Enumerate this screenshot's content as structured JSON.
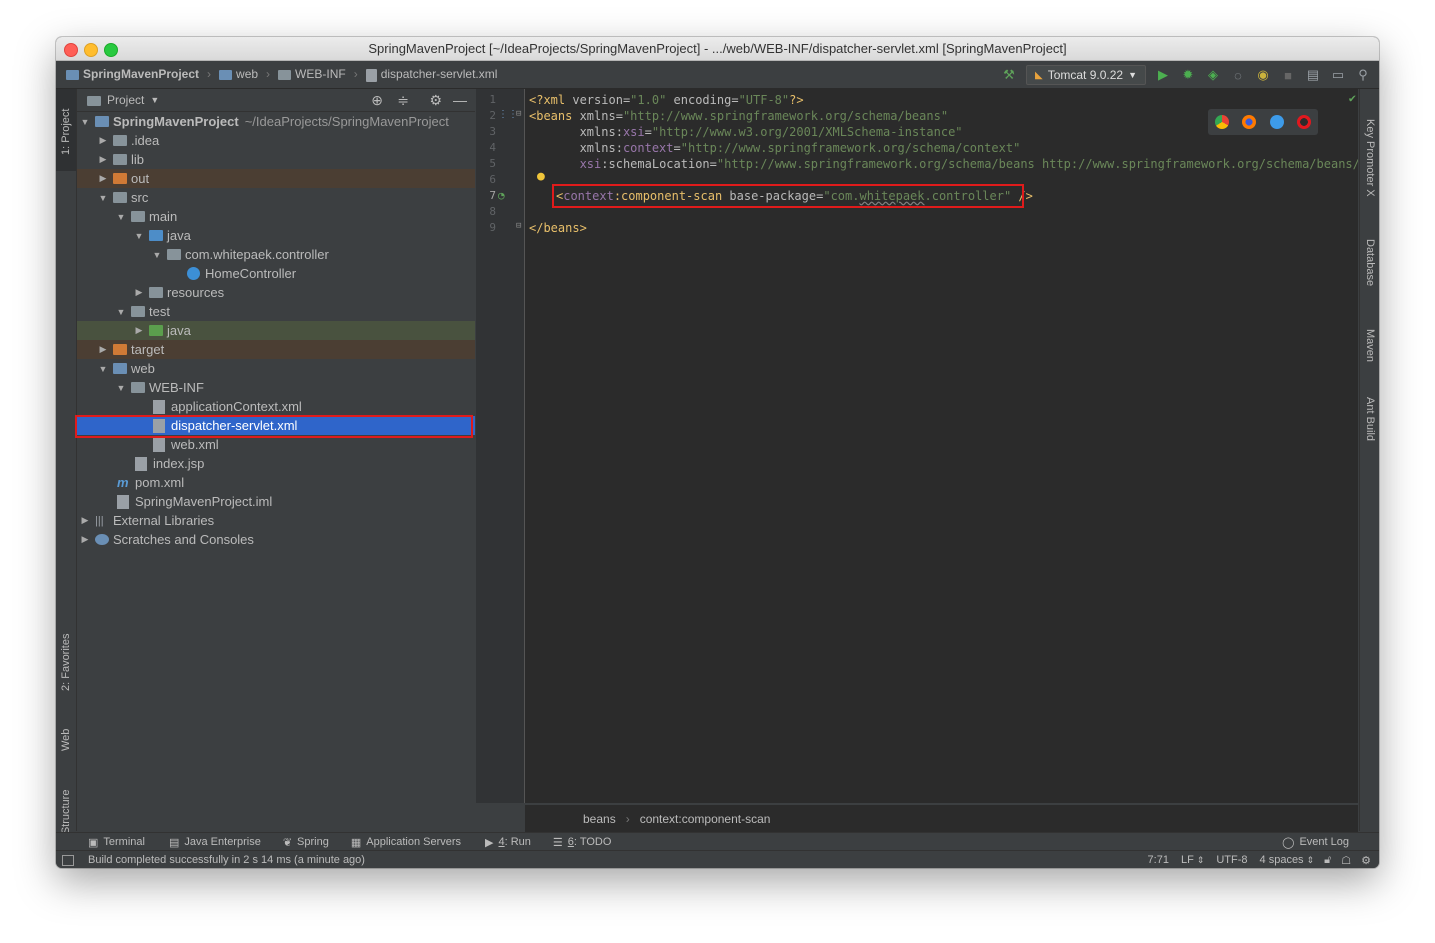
{
  "window": {
    "title": "SpringMavenProject [~/IdeaProjects/SpringMavenProject] - .../web/WEB-INF/dispatcher-servlet.xml [SpringMavenProject]"
  },
  "navbar": {
    "crumbs": [
      "SpringMavenProject",
      "web",
      "WEB-INF",
      "dispatcher-servlet.xml"
    ],
    "run_config": "Tomcat 9.0.22"
  },
  "left_tabs": [
    "1: Project",
    "2: Favorites",
    "Web",
    "Z: Structure"
  ],
  "project_panel": {
    "title": "Project",
    "tree": [
      {
        "label": "SpringMavenProject",
        "path": "~/IdeaProjects/SpringMavenProject"
      },
      {
        "label": ".idea"
      },
      {
        "label": "lib"
      },
      {
        "label": "out"
      },
      {
        "label": "src"
      },
      {
        "label": "main"
      },
      {
        "label": "java"
      },
      {
        "label": "com.whitepaek.controller"
      },
      {
        "label": "HomeController"
      },
      {
        "label": "resources"
      },
      {
        "label": "test"
      },
      {
        "label": "java"
      },
      {
        "label": "target"
      },
      {
        "label": "web"
      },
      {
        "label": "WEB-INF"
      },
      {
        "label": "applicationContext.xml"
      },
      {
        "label": "dispatcher-servlet.xml"
      },
      {
        "label": "web.xml"
      },
      {
        "label": "index.jsp"
      },
      {
        "label": "pom.xml"
      },
      {
        "label": "SpringMavenProject.iml"
      },
      {
        "label": "External Libraries"
      },
      {
        "label": "Scratches and Consoles"
      }
    ]
  },
  "editor": {
    "line_numbers": [
      "1",
      "2",
      "3",
      "4",
      "5",
      "6",
      "7",
      "8",
      "9"
    ],
    "lines": {
      "l1": {
        "open": "<?xml ",
        "a1": "version",
        "eq1": "=",
        "v1": "\"1.0\"",
        "a2": " encoding",
        "eq2": "=",
        "v2": "\"UTF-8\"",
        "close": "?>"
      },
      "l2": {
        "tag": "<beans ",
        "attr": "xmlns",
        "eq": "=",
        "val": "\"http://www.springframework.org/schema/beans\""
      },
      "l3": {
        "indent": "       ",
        "attr": "xmlns",
        "colon": ":",
        "ns": "xsi",
        "eq": "=",
        "val": "\"http://www.w3.org/2001/XMLSchema-instance\""
      },
      "l4": {
        "indent": "       ",
        "attr": "xmlns",
        "colon": ":",
        "ns": "context",
        "eq": "=",
        "val": "\"http://www.springframework.org/schema/context\""
      },
      "l5": {
        "indent": "       ",
        "ns": "xsi",
        "colon": ":",
        "attr": "schemaLocation",
        "eq": "=",
        "val": "\"http://www.springframework.org/schema/beans http://www.springframework.org/schema/beans/spri"
      },
      "l7": {
        "lt": "<",
        "ns": "context",
        "tag": ":component-scan ",
        "attr": "base-package",
        "eq": "=",
        "q1": "\"com.",
        "word": "whitepaek",
        "q2": ".controller\"",
        "close": " />"
      },
      "l9": {
        "tag": "</beans>"
      }
    }
  },
  "editor_breadcrumb": [
    "beans",
    "context:component-scan"
  ],
  "right_tabs": [
    "Key Promoter X",
    "Database",
    "Maven",
    "Ant Build"
  ],
  "tool_windows": {
    "terminal": "Terminal",
    "java_enterprise": "Java Enterprise",
    "spring": "Spring",
    "app_servers": "Application Servers",
    "run_num": "4",
    "run_label": ": Run",
    "todo_num": "6",
    "todo_label": ": TODO",
    "event_log": "Event Log"
  },
  "status": {
    "message": "Build completed successfully in 2 s 14 ms (a minute ago)",
    "position": "7:71",
    "line_sep": "LF",
    "encoding": "UTF-8",
    "indent": "4 spaces"
  },
  "colors": {
    "selection": "#2f65ca",
    "highlight_box": "#e01b1b",
    "xml_tag": "#e8bf6a",
    "xml_value": "#6a8759",
    "xml_namespace": "#9876aa"
  }
}
